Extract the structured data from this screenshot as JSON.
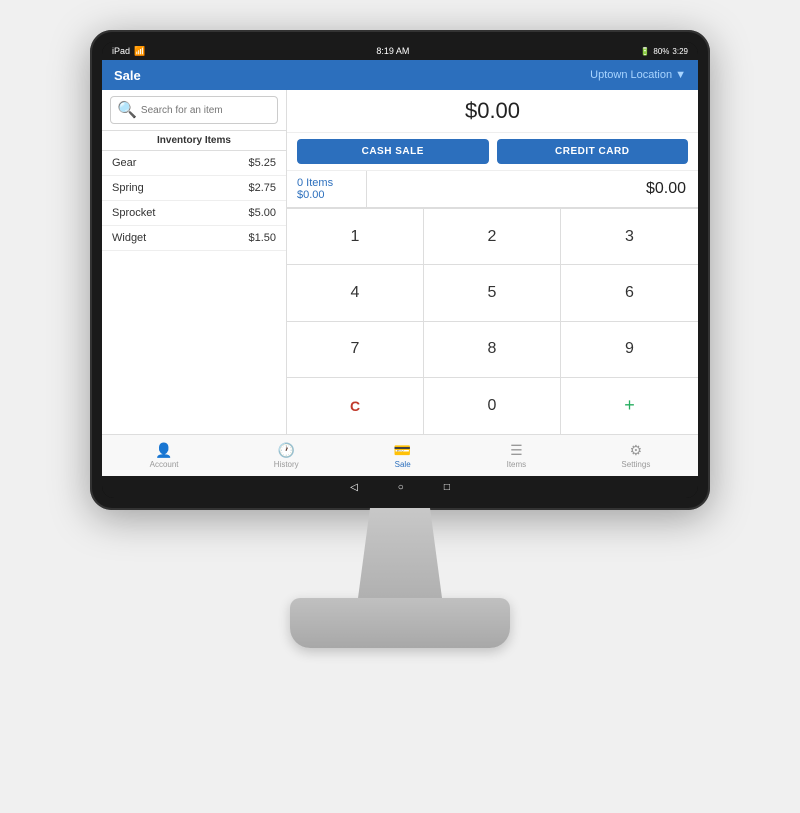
{
  "status_bar": {
    "device": "iPad",
    "wifi": "WiFi",
    "time": "8:19 AM",
    "battery": "80%"
  },
  "header": {
    "title": "Sale",
    "location": "Uptown Location",
    "dropdown_icon": "▼"
  },
  "search": {
    "placeholder": "Search for an item"
  },
  "inventory": {
    "header": "Inventory Items",
    "items": [
      {
        "name": "Gear",
        "price": "$5.25"
      },
      {
        "name": "Spring",
        "price": "$2.75"
      },
      {
        "name": "Sprocket",
        "price": "$5.00"
      },
      {
        "name": "Widget",
        "price": "$1.50"
      }
    ]
  },
  "total": "$0.00",
  "buttons": {
    "cash": "CASH SALE",
    "credit": "CREDIT CARD"
  },
  "cart": {
    "items_count": "0 Items",
    "items_total": "$0.00",
    "amount": "$0.00"
  },
  "numpad": {
    "keys": [
      "1",
      "2",
      "3",
      "4",
      "5",
      "6",
      "7",
      "8",
      "9",
      "C",
      "0",
      "+"
    ]
  },
  "bottom_nav": {
    "items": [
      {
        "id": "account",
        "label": "Account",
        "icon": "👤"
      },
      {
        "id": "history",
        "label": "History",
        "icon": "🕐"
      },
      {
        "id": "sale",
        "label": "Sale",
        "icon": "💳",
        "active": true
      },
      {
        "id": "items",
        "label": "Items",
        "icon": "☰"
      },
      {
        "id": "settings",
        "label": "Settings",
        "icon": "⚙"
      }
    ]
  },
  "android_nav": {
    "back": "◁",
    "home": "○",
    "recents": "□"
  }
}
